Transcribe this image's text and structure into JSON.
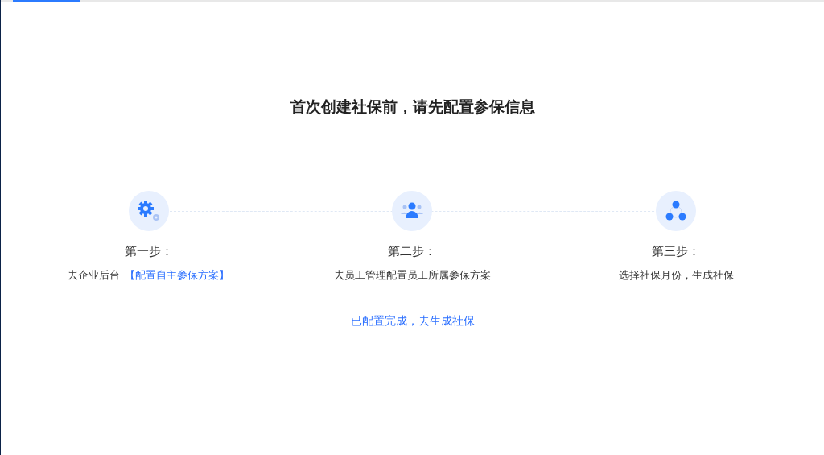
{
  "title": "首次创建社保前，请先配置参保信息",
  "steps": [
    {
      "title": "第一步：",
      "text": "去企业后台",
      "link": "【配置自主参保方案】"
    },
    {
      "title": "第二步：",
      "text": "去员工管理配置员工所属参保方案"
    },
    {
      "title": "第三步：",
      "text": "选择社保月份，生成社保"
    }
  ],
  "action_link": "已配置完成，去生成社保"
}
